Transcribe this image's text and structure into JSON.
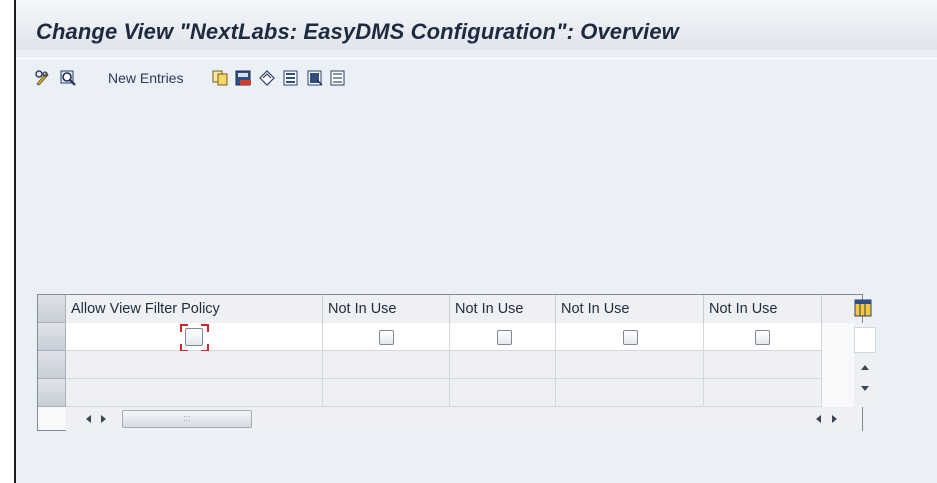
{
  "window": {
    "title": "Change View \"NextLabs: EasyDMS Configuration\": Overview"
  },
  "toolbar": {
    "new_entries_label": "New Entries",
    "icons": [
      "display-change-icon",
      "details-icon",
      "copy-icon",
      "delete-icon",
      "undo-icon",
      "select-all-icon",
      "select-block-icon",
      "deselect-all-icon"
    ]
  },
  "table": {
    "columns": [
      "Allow View Filter Policy",
      "Not In Use",
      "Not In Use",
      "Not In Use",
      "Not In Use"
    ],
    "rows": [
      {
        "values": [
          false,
          false,
          false,
          false,
          false
        ],
        "focused_col": 0
      },
      {
        "values": null
      },
      {
        "values": null
      }
    ],
    "horizontal_scroll_grip": ":::"
  },
  "colors": {
    "title_text": "#1d2a3f",
    "background": "#ebeff6",
    "focus_mark": "#d32626"
  }
}
